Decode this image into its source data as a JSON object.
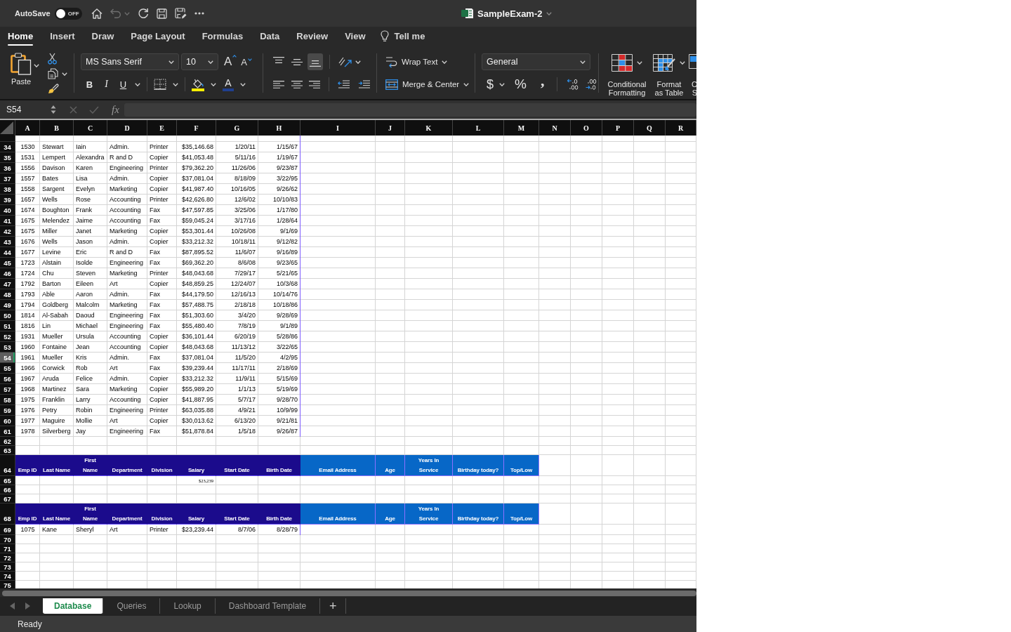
{
  "title_bar": {
    "autosave": {
      "label": "AutoSave",
      "on": false,
      "state_text": "OFF"
    },
    "undo_disabled": true,
    "document_title": "SampleExam-2"
  },
  "ribbon_tabs": [
    {
      "label": "Home",
      "selected": true
    },
    {
      "label": "Insert",
      "selected": false
    },
    {
      "label": "Draw",
      "selected": false
    },
    {
      "label": "Page Layout",
      "selected": false
    },
    {
      "label": "Formulas",
      "selected": false
    },
    {
      "label": "Data",
      "selected": false
    },
    {
      "label": "Review",
      "selected": false
    },
    {
      "label": "View",
      "selected": false
    }
  ],
  "tell_me": "Tell me",
  "ribbon": {
    "paste": "Paste",
    "font_name": "MS Sans Serif",
    "font_size": "10",
    "grow_font": "A",
    "shrink_font": "A",
    "style_buttons": [
      "B",
      "I",
      "U"
    ],
    "font_color": "A",
    "vertical_align": [
      {
        "kind": "top",
        "selected": false
      },
      {
        "kind": "middle",
        "selected": false
      },
      {
        "kind": "bottom",
        "selected": true
      }
    ],
    "horizontal_align": [
      {
        "kind": "left",
        "selected": false
      },
      {
        "kind": "center",
        "selected": false
      },
      {
        "kind": "right",
        "selected": false
      }
    ],
    "wrap_text": "Wrap Text",
    "merge_center": "Merge & Center",
    "number_format": "General",
    "number_buttons": [
      "$",
      "%",
      ","
    ],
    "style_groups": [
      {
        "kind": "conditional",
        "lines": [
          "Conditional",
          "Formatting"
        ]
      },
      {
        "kind": "table",
        "lines": [
          "Format",
          "as Table"
        ]
      },
      {
        "kind": "styles",
        "lines": [
          "C",
          "S"
        ]
      }
    ]
  },
  "formula_bar": {
    "name_box": "S54",
    "edit_disabled": true,
    "fx": "fx"
  },
  "sheet": {
    "columns": [
      "A",
      "B",
      "C",
      "D",
      "E",
      "F",
      "G",
      "H",
      "I",
      "J",
      "K",
      "L",
      "M",
      "N",
      "O",
      "P",
      "Q",
      "R"
    ],
    "rows": [
      {
        "number": "34",
        "kind": "data",
        "selected": false,
        "cells": [
          "1530",
          "Stewart",
          "Iain",
          "Admin.",
          "Printer",
          "$35,146.68",
          "1/20/11",
          "1/15/67"
        ]
      },
      {
        "number": "35",
        "kind": "data",
        "selected": false,
        "cells": [
          "1531",
          "Lempert",
          "Alexandra",
          "R and D",
          "Copier",
          "$41,053.48",
          "5/11/16",
          "1/19/67"
        ]
      },
      {
        "number": "36",
        "kind": "data",
        "selected": false,
        "cells": [
          "1556",
          "Davison",
          "Karen",
          "Engineering",
          "Printer",
          "$79,362.20",
          "11/26/06",
          "9/23/87"
        ]
      },
      {
        "number": "37",
        "kind": "data",
        "selected": false,
        "cells": [
          "1557",
          "Bates",
          "Lisa",
          "Admin.",
          "Copier",
          "$37,081.04",
          "8/18/09",
          "3/22/95"
        ]
      },
      {
        "number": "38",
        "kind": "data",
        "selected": false,
        "cells": [
          "1558",
          "Sargent",
          "Evelyn",
          "Marketing",
          "Copier",
          "$41,987.40",
          "10/16/05",
          "9/26/62"
        ]
      },
      {
        "number": "39",
        "kind": "data",
        "selected": false,
        "cells": [
          "1657",
          "Wells",
          "Rose",
          "Accounting",
          "Printer",
          "$42,626.80",
          "12/6/02",
          "10/10/83"
        ]
      },
      {
        "number": "40",
        "kind": "data",
        "selected": false,
        "cells": [
          "1674",
          "Boughton",
          "Frank",
          "Accounting",
          "Fax",
          "$47,597.85",
          "3/25/06",
          "1/17/80"
        ]
      },
      {
        "number": "41",
        "kind": "data",
        "selected": false,
        "cells": [
          "1675",
          "Melendez",
          "Jaime",
          "Accounting",
          "Fax",
          "$59,045.24",
          "3/17/16",
          "1/28/64"
        ]
      },
      {
        "number": "42",
        "kind": "data",
        "selected": false,
        "cells": [
          "1675",
          "Miller",
          "Janet",
          "Marketing",
          "Copier",
          "$53,301.44",
          "10/26/08",
          "9/1/69"
        ]
      },
      {
        "number": "43",
        "kind": "data",
        "selected": false,
        "cells": [
          "1676",
          "Wells",
          "Jason",
          "Admin.",
          "Copier",
          "$33,212.32",
          "10/18/11",
          "9/12/82"
        ]
      },
      {
        "number": "44",
        "kind": "data",
        "selected": false,
        "cells": [
          "1677",
          "Levine",
          "Eric",
          "R and D",
          "Fax",
          "$87,895.52",
          "11/6/07",
          "9/16/89"
        ]
      },
      {
        "number": "45",
        "kind": "data",
        "selected": false,
        "cells": [
          "1723",
          "Alstain",
          "Isolde",
          "Engineering",
          "Fax",
          "$69,362.20",
          "8/6/08",
          "9/23/65"
        ]
      },
      {
        "number": "46",
        "kind": "data",
        "selected": false,
        "cells": [
          "1724",
          "Chu",
          "Steven",
          "Marketing",
          "Printer",
          "$48,043.68",
          "7/29/17",
          "5/21/65"
        ]
      },
      {
        "number": "47",
        "kind": "data",
        "selected": false,
        "cells": [
          "1792",
          "Barton",
          "Eileen",
          "Art",
          "Copier",
          "$48,859.25",
          "12/24/07",
          "10/3/68"
        ]
      },
      {
        "number": "48",
        "kind": "data",
        "selected": false,
        "cells": [
          "1793",
          "Able",
          "Aaron",
          "Admin.",
          "Fax",
          "$44,179.50",
          "12/16/13",
          "10/14/76"
        ]
      },
      {
        "number": "49",
        "kind": "data",
        "selected": false,
        "cells": [
          "1794",
          "Goldberg",
          "Malcolm",
          "Marketing",
          "Fax",
          "$57,488.75",
          "2/18/18",
          "10/18/86"
        ]
      },
      {
        "number": "50",
        "kind": "data",
        "selected": false,
        "cells": [
          "1814",
          "Al-Sabah",
          "Daoud",
          "Engineering",
          "Fax",
          "$51,303.60",
          "3/4/20",
          "9/28/69"
        ]
      },
      {
        "number": "51",
        "kind": "data",
        "selected": false,
        "cells": [
          "1816",
          "Lin",
          "Michael",
          "Engineering",
          "Fax",
          "$55,480.40",
          "7/8/19",
          "9/1/89"
        ]
      },
      {
        "number": "52",
        "kind": "data",
        "selected": false,
        "cells": [
          "1931",
          "Mueller",
          "Ursula",
          "Accounting",
          "Copier",
          "$36,101.44",
          "6/20/19",
          "5/28/86"
        ]
      },
      {
        "number": "53",
        "kind": "data",
        "selected": false,
        "cells": [
          "1960",
          "Fontaine",
          "Jean",
          "Accounting",
          "Copier",
          "$48,043.68",
          "11/13/12",
          "3/22/65"
        ]
      },
      {
        "number": "54",
        "kind": "data",
        "selected": true,
        "cells": [
          "1961",
          "Mueller",
          "Kris",
          "Admin.",
          "Fax",
          "$37,081.04",
          "11/5/20",
          "4/2/95"
        ]
      },
      {
        "number": "55",
        "kind": "data",
        "selected": false,
        "cells": [
          "1966",
          "Corwick",
          "Rob",
          "Art",
          "Fax",
          "$39,239.44",
          "11/17/11",
          "2/18/69"
        ]
      },
      {
        "number": "56",
        "kind": "data",
        "selected": false,
        "cells": [
          "1967",
          "Aruda",
          "Felice",
          "Admin.",
          "Copier",
          "$33,212.32",
          "11/9/11",
          "5/15/69"
        ]
      },
      {
        "number": "57",
        "kind": "data",
        "selected": false,
        "cells": [
          "1968",
          "Martinez",
          "Sara",
          "Marketing",
          "Copier",
          "$55,989.20",
          "1/1/13",
          "5/19/69"
        ]
      },
      {
        "number": "58",
        "kind": "data",
        "selected": false,
        "cells": [
          "1975",
          "Franklin",
          "Larry",
          "Accounting",
          "Copier",
          "$41,887.95",
          "5/7/17",
          "9/28/70"
        ]
      },
      {
        "number": "59",
        "kind": "data",
        "selected": false,
        "cells": [
          "1976",
          "Petry",
          "Robin",
          "Engineering",
          "Printer",
          "$63,035.88",
          "4/9/21",
          "10/9/99"
        ]
      },
      {
        "number": "60",
        "kind": "data",
        "selected": false,
        "cells": [
          "1977",
          "Maguire",
          "Mollie",
          "Art",
          "Copier",
          "$30,013.62",
          "6/13/20",
          "9/21/81"
        ]
      },
      {
        "number": "61",
        "kind": "data",
        "selected": false,
        "cells": [
          "1978",
          "Silverberg",
          "Jay",
          "Engineering",
          "Fax",
          "$51,878.84",
          "1/5/18",
          "9/26/87"
        ]
      },
      {
        "number": "62",
        "kind": "blank",
        "selected": false
      },
      {
        "number": "63",
        "kind": "blank",
        "selected": false
      },
      {
        "number": "64",
        "kind": "header",
        "selected": false,
        "cells": [
          "Emp ID",
          "Last Name",
          "First\nName",
          "Department",
          "Division",
          "Salary",
          "Start Date",
          "Birth Date",
          "Email Address",
          "Age",
          "Years In\nService",
          "Birthday today?",
          "Top/Low"
        ]
      },
      {
        "number": "65",
        "kind": "note",
        "selected": false,
        "cells": [
          null,
          null,
          null,
          null,
          null,
          "$23,239"
        ]
      },
      {
        "number": "66",
        "kind": "blank",
        "selected": false
      },
      {
        "number": "67",
        "kind": "blank",
        "selected": false
      },
      {
        "number": "68",
        "kind": "header",
        "selected": false,
        "cells": [
          "Emp ID",
          "Last Name",
          "First\nName",
          "Department",
          "Division",
          "Salary",
          "Start Date",
          "Birth Date",
          "Email Address",
          "Age",
          "Years In\nService",
          "Birthday today?",
          "Top/Low"
        ]
      },
      {
        "number": "69",
        "kind": "data",
        "selected": false,
        "cells": [
          "1075",
          "Kane",
          "Sheryl",
          "Art",
          "Printer",
          "$23,239.44",
          "8/7/06",
          "8/28/79"
        ]
      },
      {
        "number": "70",
        "kind": "blank",
        "selected": false
      },
      {
        "number": "71",
        "kind": "blank",
        "selected": false
      },
      {
        "number": "72",
        "kind": "blank",
        "selected": false
      },
      {
        "number": "73",
        "kind": "blank",
        "selected": false
      },
      {
        "number": "74",
        "kind": "blank",
        "selected": false
      },
      {
        "number": "75",
        "kind": "blank",
        "selected": false
      }
    ]
  },
  "sheet_tabs": [
    {
      "label": "Database",
      "selected": true
    },
    {
      "label": "Queries",
      "selected": false
    },
    {
      "label": "Lookup",
      "selected": false
    },
    {
      "label": "Dashboard Template",
      "selected": false
    }
  ],
  "add_sheet": "+",
  "status_bar": "Ready"
}
